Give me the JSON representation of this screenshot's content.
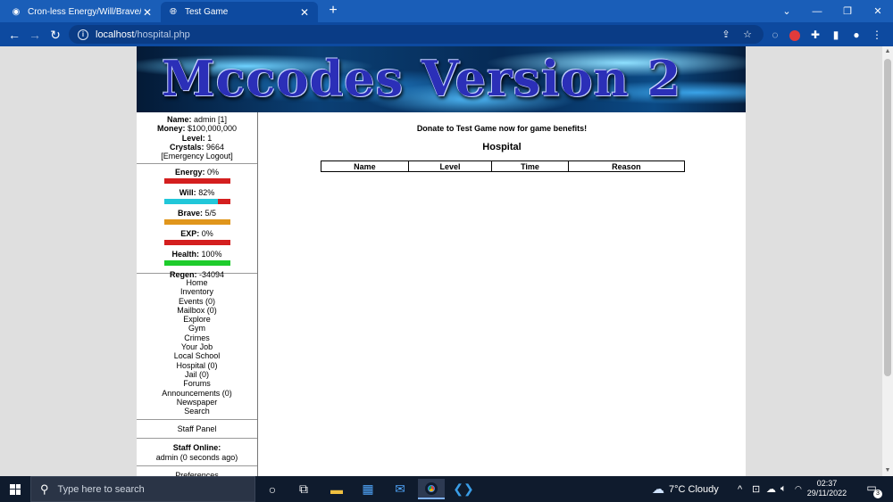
{
  "browser": {
    "tabs": [
      {
        "title": "Cron-less Energy/Will/Brave/HP F",
        "favicon": "eye-icon",
        "active": false
      },
      {
        "title": "Test Game",
        "favicon": "globe-icon",
        "active": true
      }
    ],
    "url_host": "localhost",
    "url_path": "/hospital.php"
  },
  "banner": {
    "title": "Mccodes Version 2"
  },
  "sidebar": {
    "info": {
      "name_label": "Name:",
      "name_value": "admin [1]",
      "money_label": "Money:",
      "money_value": "$100,000,000",
      "level_label": "Level:",
      "level_value": "1",
      "crystals_label": "Crystals:",
      "crystals_value": "9664",
      "logout": "[Emergency Logout]"
    },
    "stats": [
      {
        "label": "Energy:",
        "value": "0%",
        "fill": 0,
        "fill_color": "#21c7d9",
        "empty_color": "#d41f1f"
      },
      {
        "label": "Will:",
        "value": "82%",
        "fill": 0.82,
        "fill_color": "#21c7d9",
        "empty_color": "#d41f1f"
      },
      {
        "label": "Brave:",
        "value": "5/5",
        "fill": 1.0,
        "fill_color": "#e0961c",
        "empty_color": "#d41f1f"
      },
      {
        "label": "EXP:",
        "value": "0%",
        "fill": 0,
        "fill_color": "#21c7d9",
        "empty_color": "#d41f1f"
      },
      {
        "label": "Health:",
        "value": "100%",
        "fill": 1.0,
        "fill_color": "#1ecc2c",
        "empty_color": "#d41f1f"
      }
    ],
    "regen_label": "Regen:",
    "regen_value": "-34094",
    "nav": [
      "Home",
      "Inventory",
      "Events (0)",
      "Mailbox (0)",
      "Explore",
      "Gym",
      "Crimes",
      "Your Job",
      "Local School",
      "Hospital (0)",
      "Jail (0)",
      "Forums",
      "Announcements (0)",
      "Newspaper",
      "Search"
    ],
    "staff_panel": "Staff Panel",
    "staff_online_label": "Staff Online:",
    "staff_online_value": "admin (0 seconds ago)",
    "preferences": "Preferences"
  },
  "main": {
    "donate": "Donate to Test Game now for game benefits!",
    "heading": "Hospital",
    "columns": [
      "Name",
      "Level",
      "Time",
      "Reason"
    ]
  },
  "taskbar": {
    "search_placeholder": "Type here to search",
    "weather": "7°C  Cloudy",
    "time": "02:37",
    "date": "29/11/2022",
    "notification_count": "3"
  }
}
